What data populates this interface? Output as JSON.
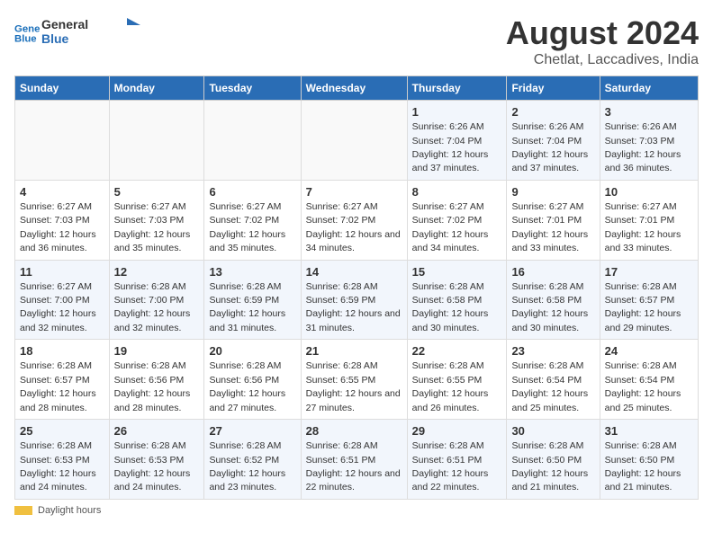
{
  "logo": {
    "line1": "General",
    "line2": "Blue"
  },
  "title": "August 2024",
  "subtitle": "Chetlat, Laccadives, India",
  "days_of_week": [
    "Sunday",
    "Monday",
    "Tuesday",
    "Wednesday",
    "Thursday",
    "Friday",
    "Saturday"
  ],
  "weeks": [
    [
      {
        "num": "",
        "info": ""
      },
      {
        "num": "",
        "info": ""
      },
      {
        "num": "",
        "info": ""
      },
      {
        "num": "",
        "info": ""
      },
      {
        "num": "1",
        "info": "Sunrise: 6:26 AM\nSunset: 7:04 PM\nDaylight: 12 hours and 37 minutes."
      },
      {
        "num": "2",
        "info": "Sunrise: 6:26 AM\nSunset: 7:04 PM\nDaylight: 12 hours and 37 minutes."
      },
      {
        "num": "3",
        "info": "Sunrise: 6:26 AM\nSunset: 7:03 PM\nDaylight: 12 hours and 36 minutes."
      }
    ],
    [
      {
        "num": "4",
        "info": "Sunrise: 6:27 AM\nSunset: 7:03 PM\nDaylight: 12 hours and 36 minutes."
      },
      {
        "num": "5",
        "info": "Sunrise: 6:27 AM\nSunset: 7:03 PM\nDaylight: 12 hours and 35 minutes."
      },
      {
        "num": "6",
        "info": "Sunrise: 6:27 AM\nSunset: 7:02 PM\nDaylight: 12 hours and 35 minutes."
      },
      {
        "num": "7",
        "info": "Sunrise: 6:27 AM\nSunset: 7:02 PM\nDaylight: 12 hours and 34 minutes."
      },
      {
        "num": "8",
        "info": "Sunrise: 6:27 AM\nSunset: 7:02 PM\nDaylight: 12 hours and 34 minutes."
      },
      {
        "num": "9",
        "info": "Sunrise: 6:27 AM\nSunset: 7:01 PM\nDaylight: 12 hours and 33 minutes."
      },
      {
        "num": "10",
        "info": "Sunrise: 6:27 AM\nSunset: 7:01 PM\nDaylight: 12 hours and 33 minutes."
      }
    ],
    [
      {
        "num": "11",
        "info": "Sunrise: 6:27 AM\nSunset: 7:00 PM\nDaylight: 12 hours and 32 minutes."
      },
      {
        "num": "12",
        "info": "Sunrise: 6:28 AM\nSunset: 7:00 PM\nDaylight: 12 hours and 32 minutes."
      },
      {
        "num": "13",
        "info": "Sunrise: 6:28 AM\nSunset: 6:59 PM\nDaylight: 12 hours and 31 minutes."
      },
      {
        "num": "14",
        "info": "Sunrise: 6:28 AM\nSunset: 6:59 PM\nDaylight: 12 hours and 31 minutes."
      },
      {
        "num": "15",
        "info": "Sunrise: 6:28 AM\nSunset: 6:58 PM\nDaylight: 12 hours and 30 minutes."
      },
      {
        "num": "16",
        "info": "Sunrise: 6:28 AM\nSunset: 6:58 PM\nDaylight: 12 hours and 30 minutes."
      },
      {
        "num": "17",
        "info": "Sunrise: 6:28 AM\nSunset: 6:57 PM\nDaylight: 12 hours and 29 minutes."
      }
    ],
    [
      {
        "num": "18",
        "info": "Sunrise: 6:28 AM\nSunset: 6:57 PM\nDaylight: 12 hours and 28 minutes."
      },
      {
        "num": "19",
        "info": "Sunrise: 6:28 AM\nSunset: 6:56 PM\nDaylight: 12 hours and 28 minutes."
      },
      {
        "num": "20",
        "info": "Sunrise: 6:28 AM\nSunset: 6:56 PM\nDaylight: 12 hours and 27 minutes."
      },
      {
        "num": "21",
        "info": "Sunrise: 6:28 AM\nSunset: 6:55 PM\nDaylight: 12 hours and 27 minutes."
      },
      {
        "num": "22",
        "info": "Sunrise: 6:28 AM\nSunset: 6:55 PM\nDaylight: 12 hours and 26 minutes."
      },
      {
        "num": "23",
        "info": "Sunrise: 6:28 AM\nSunset: 6:54 PM\nDaylight: 12 hours and 25 minutes."
      },
      {
        "num": "24",
        "info": "Sunrise: 6:28 AM\nSunset: 6:54 PM\nDaylight: 12 hours and 25 minutes."
      }
    ],
    [
      {
        "num": "25",
        "info": "Sunrise: 6:28 AM\nSunset: 6:53 PM\nDaylight: 12 hours and 24 minutes."
      },
      {
        "num": "26",
        "info": "Sunrise: 6:28 AM\nSunset: 6:53 PM\nDaylight: 12 hours and 24 minutes."
      },
      {
        "num": "27",
        "info": "Sunrise: 6:28 AM\nSunset: 6:52 PM\nDaylight: 12 hours and 23 minutes."
      },
      {
        "num": "28",
        "info": "Sunrise: 6:28 AM\nSunset: 6:51 PM\nDaylight: 12 hours and 22 minutes."
      },
      {
        "num": "29",
        "info": "Sunrise: 6:28 AM\nSunset: 6:51 PM\nDaylight: 12 hours and 22 minutes."
      },
      {
        "num": "30",
        "info": "Sunrise: 6:28 AM\nSunset: 6:50 PM\nDaylight: 12 hours and 21 minutes."
      },
      {
        "num": "31",
        "info": "Sunrise: 6:28 AM\nSunset: 6:50 PM\nDaylight: 12 hours and 21 minutes."
      }
    ]
  ],
  "legend": {
    "label": "Daylight hours"
  }
}
